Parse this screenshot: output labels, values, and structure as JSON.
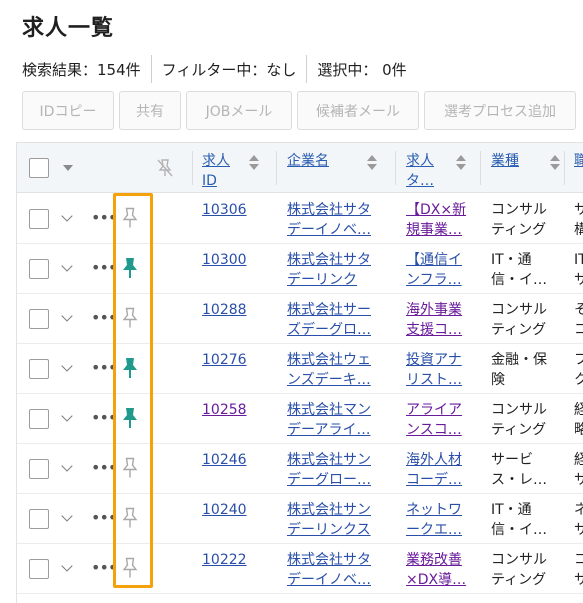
{
  "page": {
    "title": "求人一覧"
  },
  "status": {
    "results": "検索結果：154件",
    "filter": "フィルター中：なし",
    "selected": "選択中：  0件"
  },
  "toolbar": {
    "id_copy": "IDコピー",
    "share": "共有",
    "job_mail": "JOBメール",
    "candidate_mail": "候補者メール",
    "add_process": "選考プロセス追加"
  },
  "table": {
    "headers": {
      "job_id": "求人\nID",
      "company": "企業名",
      "job_title": "求人\nタ…",
      "industry": "業種",
      "next": "職"
    },
    "rows": [
      {
        "id": "10306",
        "company": "株式会社サタ\nデーイノベ…",
        "title": "【DX×新\n規事業…",
        "industry": "コンサル\nティング",
        "next": "サ\n構",
        "pinned": false,
        "id_visited": false,
        "title_visited": true
      },
      {
        "id": "10300",
        "company": "株式会社サタ\nデーリンク",
        "title": "【通信イ\nンフラ…",
        "industry": "IT・通\n信・イ…",
        "next": "IT\nサ",
        "pinned": true,
        "id_visited": false,
        "title_visited": false
      },
      {
        "id": "10288",
        "company": "株式会社サー\nズデーグロ…",
        "title": "海外事業\n支援コ…",
        "industry": "コンサル\nティング",
        "next": "そ\nコ",
        "pinned": false,
        "id_visited": false,
        "title_visited": true
      },
      {
        "id": "10276",
        "company": "株式会社ウェ\nンズデーキ…",
        "title": "投資アナ\nリスト…",
        "industry": "金融・保\n険",
        "next": "フ\nク",
        "pinned": true,
        "id_visited": false,
        "title_visited": false
      },
      {
        "id": "10258",
        "company": "株式会社マン\nデーアライ…",
        "title": "アライア\nンスコ…",
        "industry": "コンサル\nティング",
        "next": "経\n略",
        "pinned": true,
        "id_visited": true,
        "title_visited": true
      },
      {
        "id": "10246",
        "company": "株式会社サン\nデーグロー…",
        "title": "海外人材\nコーデ…",
        "industry": "サービ\nス・レ…",
        "next": "経\nサ",
        "pinned": false,
        "id_visited": false,
        "title_visited": false
      },
      {
        "id": "10240",
        "company": "株式会社サン\nデーリンクス",
        "title": "ネットワ\nークエ…",
        "industry": "IT・通\n信・イ…",
        "next": "ネ\nサ",
        "pinned": false,
        "id_visited": false,
        "title_visited": false
      },
      {
        "id": "10222",
        "company": "株式会社サタ\nデーイノベ…",
        "title": "業務改善\n×DX導…",
        "industry": "コンサル\nティング",
        "next": "コ\nサ",
        "pinned": false,
        "id_visited": false,
        "title_visited": true
      }
    ]
  },
  "colors": {
    "accent": "#f5a20a",
    "pin_active": "#1f9a8c",
    "pin_inactive": "#a8a8a8",
    "link": "#2a4fa8",
    "visited": "#6a1b9a"
  },
  "icons": {
    "pin": "pin-icon",
    "unpin": "pin-off-icon",
    "row_menu": "more-horizontal-icon",
    "expand": "chevron-down-icon",
    "sort": "sort-icon"
  }
}
